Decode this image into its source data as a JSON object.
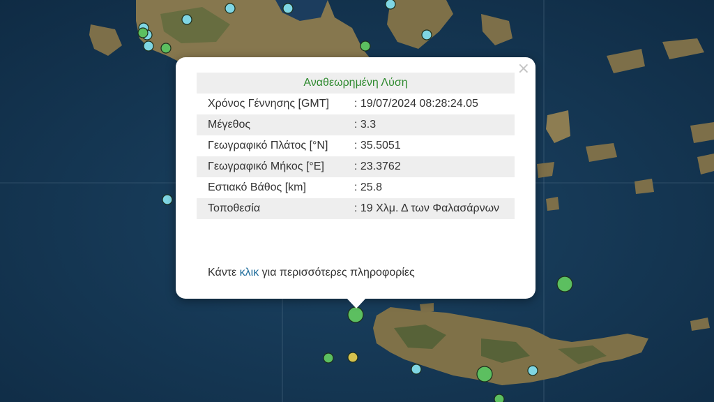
{
  "map": {
    "colors": {
      "sea": "#14344f",
      "land": "#8c7c52",
      "land_green": "#4f5f36",
      "grid": "#6f8aa0"
    },
    "events": [
      {
        "color": "#7fd6e4",
        "magnitude": "small"
      },
      {
        "color": "#7fd6e4",
        "magnitude": "small"
      },
      {
        "color": "#7fd6e4",
        "magnitude": "small"
      },
      {
        "color": "#7fd6e4",
        "magnitude": "small"
      },
      {
        "color": "#7fd6e4",
        "magnitude": "small"
      },
      {
        "color": "#7fd6e4",
        "magnitude": "small"
      },
      {
        "color": "#7fd6e4",
        "magnitude": "small"
      },
      {
        "color": "#7fd6e4",
        "magnitude": "small"
      },
      {
        "color": "#7fd6e4",
        "magnitude": "small"
      },
      {
        "color": "#7fd6e4",
        "magnitude": "small"
      },
      {
        "color": "#5cbf60",
        "magnitude": "small"
      },
      {
        "color": "#5cbf60",
        "magnitude": "small"
      },
      {
        "color": "#5cbf60",
        "magnitude": "small"
      },
      {
        "color": "#5cbf60",
        "magnitude": "medium"
      },
      {
        "color": "#5cbf60",
        "magnitude": "medium"
      },
      {
        "color": "#5cbf60",
        "magnitude": "small"
      },
      {
        "color": "#d6c24e",
        "magnitude": "small"
      },
      {
        "color": "#5cbf60",
        "magnitude": "medium"
      },
      {
        "color": "#7fd6e4",
        "magnitude": "small"
      },
      {
        "color": "#5cbf60",
        "magnitude": "small"
      }
    ]
  },
  "popup": {
    "header": "Αναθεωρημένη Λύση",
    "header_color": "#2f8a2f",
    "close_icon": "close-icon",
    "rows": [
      {
        "label": "Χρόνος Γέννησης [GMT]",
        "value": ": 19/07/2024 08:28:24.05"
      },
      {
        "label": "Μέγεθος",
        "value": ": 3.3"
      },
      {
        "label": "Γεωγραφικό Πλάτος [°N]",
        "value": ": 35.5051"
      },
      {
        "label": "Γεωγραφικό Μήκος [°E]",
        "value": ": 23.3762"
      },
      {
        "label": "Εστιακό Βάθος [km]",
        "value": ": 25.8"
      },
      {
        "label": "Τοποθεσία",
        "value": ": 19 Χλμ. Δ των Φαλασάρνων"
      }
    ],
    "more_prefix": "Κάντε",
    "more_link": "κλικ",
    "more_suffix": "για περισσότερες πληροφορίες",
    "link_color": "#1b6a9a"
  }
}
